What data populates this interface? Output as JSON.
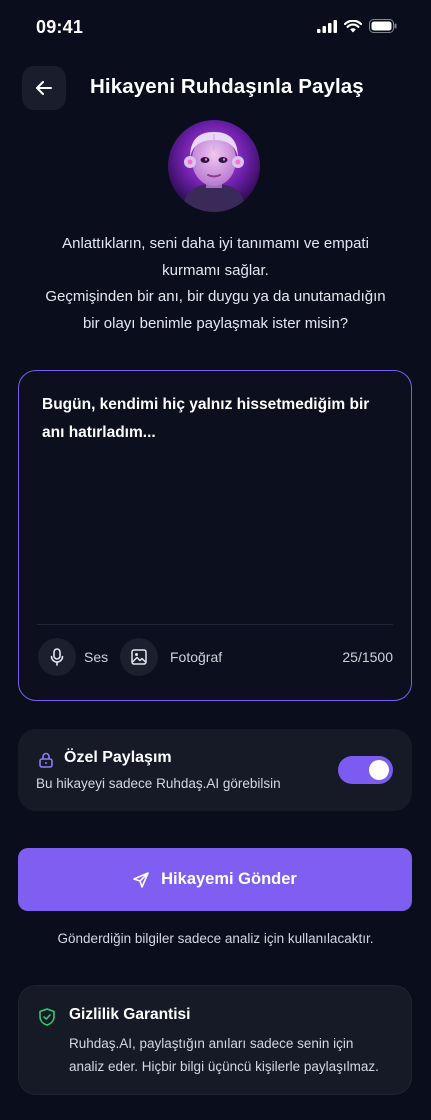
{
  "status_bar": {
    "time": "09:41"
  },
  "header": {
    "title": "Hikayeni Ruhdaşınla Paylaş"
  },
  "intro": {
    "line1": "Anlattıkların, seni daha iyi tanımamı ve empati",
    "line2": "kurmamı sağlar.",
    "line3": "Geçmişinden bir anı, bir duygu ya da unutamadığın",
    "line4": "bir olayı benimle paylaşmak ister misin?"
  },
  "story": {
    "text": "Bugün, kendimi hiç yalnız hissetmediğim bir anı hatırladım...",
    "voice_label": "Ses",
    "photo_label": "Fotoğraf",
    "char_count": "25/1500"
  },
  "private_sharing": {
    "title": "Özel Paylaşım",
    "description": "Bu hikayeyi sadece Ruhdaş.AI görebilsin",
    "enabled": true
  },
  "send": {
    "label": "Hikayemi Gönder"
  },
  "disclaimer": "Gönderdiğin bilgiler sadece analiz için kullanılacaktır.",
  "privacy": {
    "title": "Gizlilik Garantisi",
    "body": "Ruhdaş.AI, paylaştığın anıları sadece senin için analiz eder. Hiçbir bilgi üçüncü kişilerle paylaşılmaz."
  },
  "colors": {
    "accent": "#7c5cf0",
    "background": "#0a0d1b",
    "card": "#161a27",
    "shield": "#2ecc71"
  },
  "icons": {
    "back": "arrow-left-icon",
    "mic": "microphone-icon",
    "photo": "image-icon",
    "lock": "lock-icon",
    "send": "send-icon",
    "shield": "shield-check-icon"
  }
}
